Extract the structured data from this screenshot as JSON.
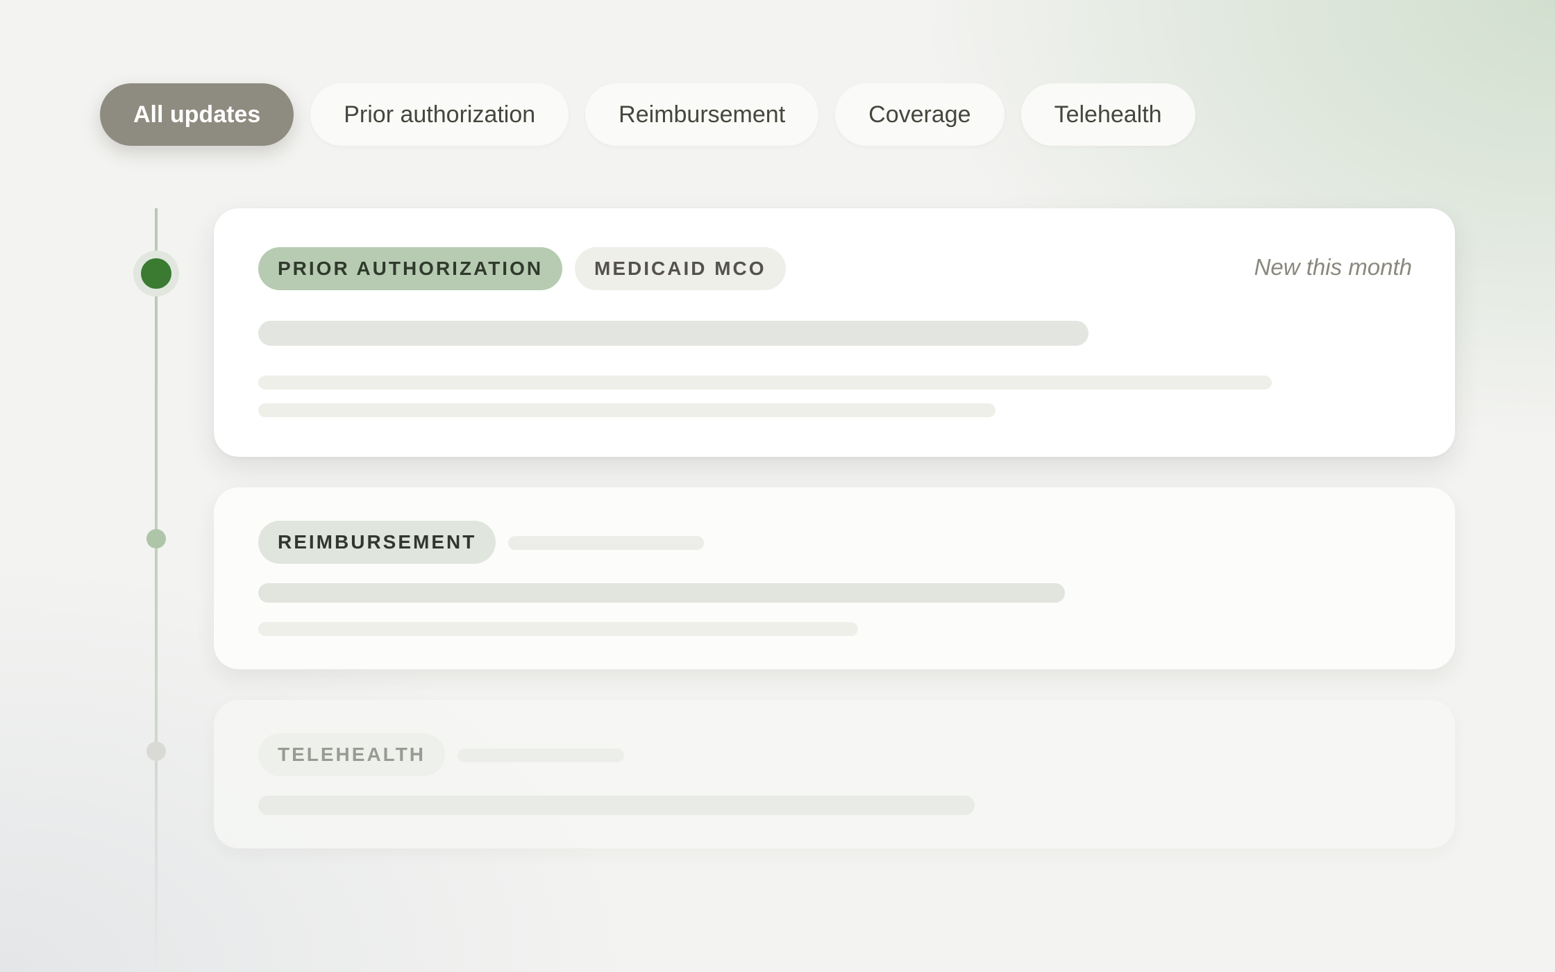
{
  "filters": [
    {
      "label": "All updates",
      "active": true
    },
    {
      "label": "Prior authorization",
      "active": false
    },
    {
      "label": "Reimbursement",
      "active": false
    },
    {
      "label": "Coverage",
      "active": false
    },
    {
      "label": "Telehealth",
      "active": false
    }
  ],
  "timeline": [
    {
      "tags": [
        "PRIOR AUTHORIZATION",
        "MEDICAID MCO"
      ],
      "status_label": "New this month",
      "state": "current"
    },
    {
      "tags": [
        "REIMBURSEMENT"
      ],
      "state": "past"
    },
    {
      "tags": [
        "TELEHEALTH"
      ],
      "state": "faded"
    }
  ],
  "colors": {
    "accent_dark_green": "#3a7b31",
    "active_chip": "#8e8b80",
    "tag_green": "#b7cbb2",
    "tag_neutral": "#eeefe9"
  }
}
